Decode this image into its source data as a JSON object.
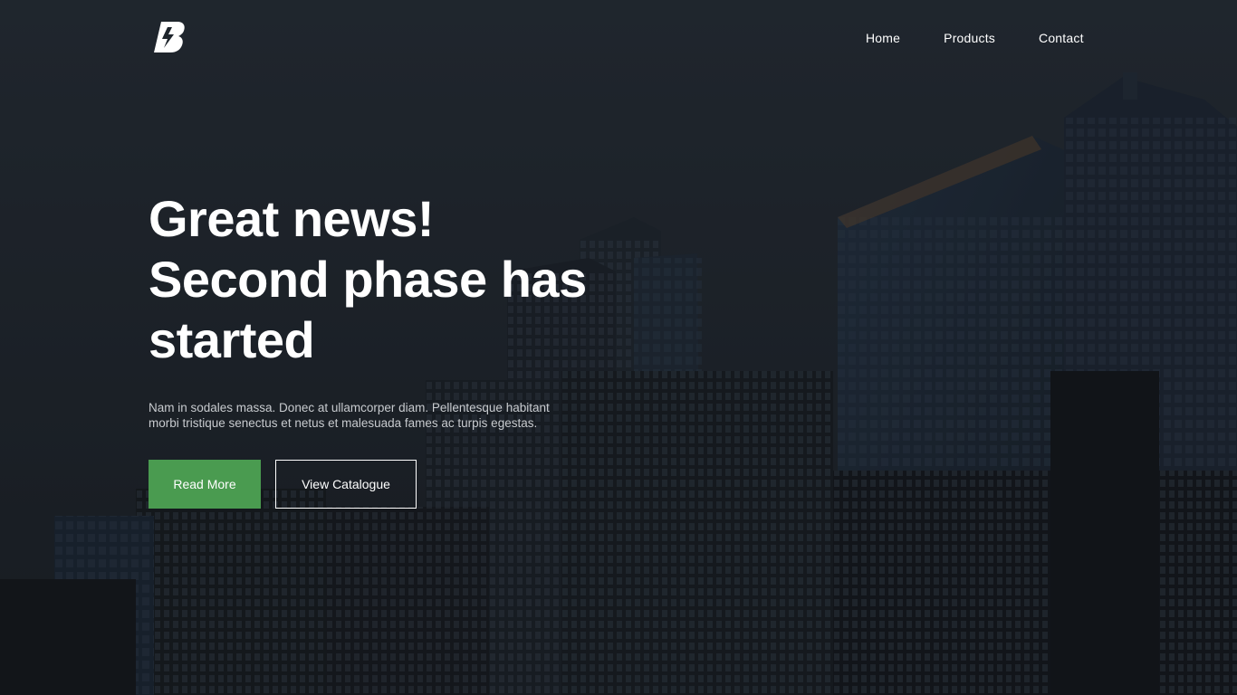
{
  "header": {
    "logo_icon": "bolt-b-logo-icon",
    "nav": [
      {
        "label": "Home"
      },
      {
        "label": "Products"
      },
      {
        "label": "Contact"
      }
    ]
  },
  "hero": {
    "headline_line1": "Great news!",
    "headline_line2": "Second phase has",
    "headline_line3": "started",
    "lead_line1": "Nam in sodales massa. Donec at ullamcorper diam. Pellentesque habitant",
    "lead_line2": "morbi tristique senectus et netus et malesuada fames ac turpis egestas.",
    "primary_button": "Read More",
    "secondary_button": "View Catalogue",
    "background_image": "city-skyscrapers-dark-overlay"
  },
  "colors": {
    "accent": "#4a9b50",
    "overlay": "#1d2329",
    "text": "#ffffff",
    "muted_text": "#c8cbcf"
  }
}
